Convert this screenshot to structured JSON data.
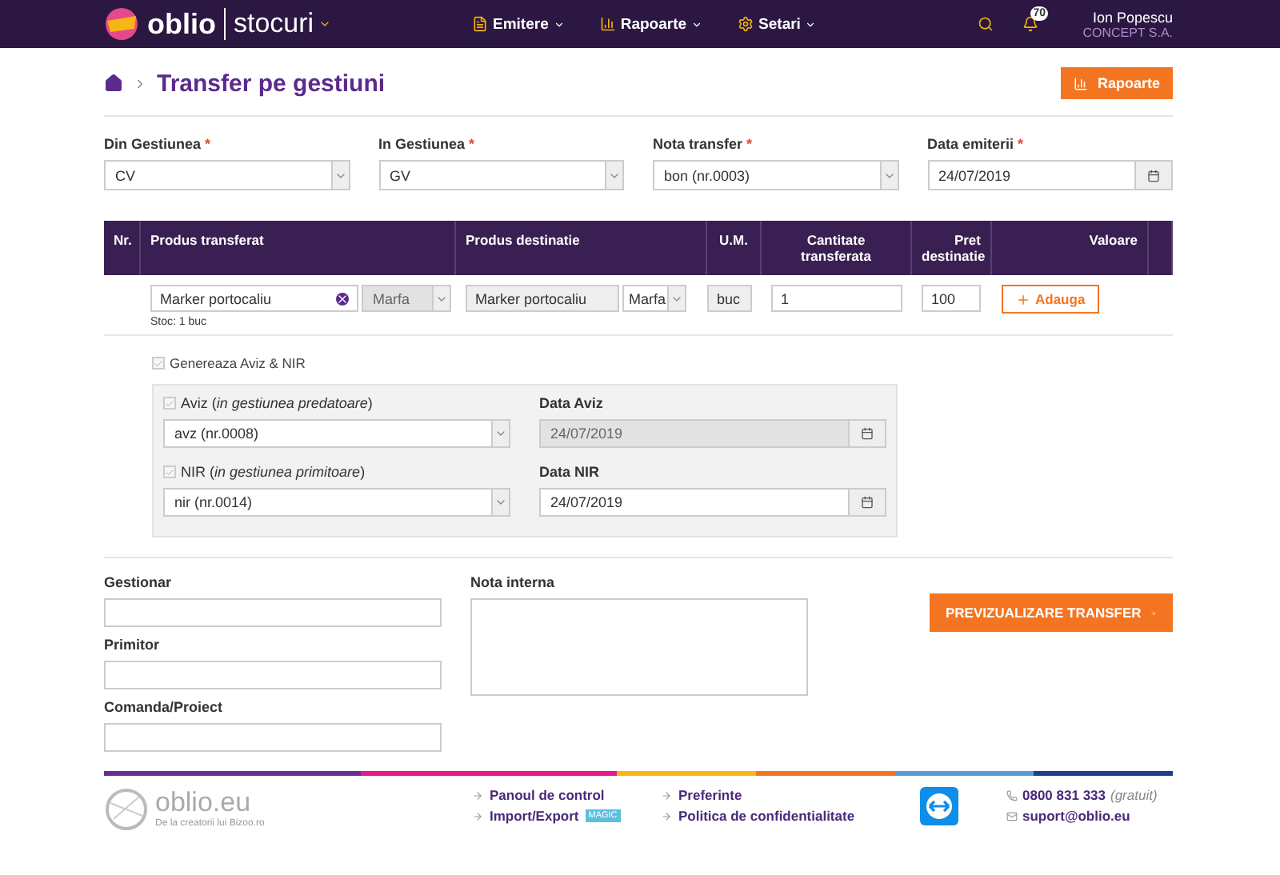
{
  "nav": {
    "logo": "oblio",
    "product": "stocuri",
    "menus": [
      {
        "label": "Emitere"
      },
      {
        "label": "Rapoarte"
      },
      {
        "label": "Setari"
      }
    ],
    "notifications": "70",
    "user": {
      "name": "Ion Popescu",
      "company": "CONCEPT S.A."
    }
  },
  "header": {
    "title": "Transfer pe gestiuni",
    "button": "Rapoarte"
  },
  "fields": [
    {
      "label": "Din Gestiunea",
      "mark": "*",
      "kind": "select",
      "value": "CV"
    },
    {
      "label": "In Gestiunea",
      "mark": "*",
      "kind": "select",
      "value": "GV"
    },
    {
      "label": "Nota transfer",
      "mark": "*",
      "kind": "select",
      "value": "bon (nr.0003)"
    },
    {
      "label": "Data emiterii",
      "mark": "*",
      "kind": "date",
      "value": "24/07/2019"
    }
  ],
  "table": {
    "columns": [
      "Nr.",
      "Produs transferat",
      "Produs destinatie",
      "U.M.",
      "Cantitate transferata",
      "Pret destinatie",
      "Valoare"
    ],
    "rows": [
      {
        "product": "Marker portocaliu",
        "type": "Marfa",
        "stock": "Stoc: 1 buc",
        "dest_product": "Marker portocaliu",
        "dest_type": "Marfa",
        "um": "buc",
        "quantity": "1",
        "price": "100",
        "button": "Adauga"
      }
    ]
  },
  "generate": {
    "label": "Genereaza Aviz & NIR",
    "checked": true
  },
  "documents": [
    {
      "label": "Aviz (*in gestiunea predatoare*)",
      "checked": true,
      "value": "avz (nr.0008)",
      "date_label": "Data Aviz",
      "date": "24/07/2019",
      "date_disabled": true
    },
    {
      "label": "NIR (*in gestiunea primitoare*)",
      "checked": true,
      "value": "nir (nr.0014)",
      "date_label": "Data NIR",
      "date": "24/07/2019",
      "date_disabled": false
    }
  ],
  "bottom": {
    "fields": [
      {
        "label": "Gestionar"
      },
      {
        "label": "Primitor"
      },
      {
        "label": "Comanda/Proiect"
      }
    ],
    "note_label": "Nota interna",
    "submit": "PREVIZUALIZARE TRANSFER"
  },
  "footer": {
    "logo": "oblio.eu",
    "tagline": "De la creatorii lui Bizoo.ro",
    "columns": [
      [
        {
          "label": "Panoul de control"
        },
        {
          "label": "Import/Export",
          "badge": "MAGIC"
        }
      ],
      [
        {
          "label": "Preferinte"
        },
        {
          "label": "Politica de confidentialitate"
        }
      ]
    ],
    "phone": "0800 831 333",
    "phone_note": "(gratuit)",
    "email": "suport@oblio.eu"
  }
}
